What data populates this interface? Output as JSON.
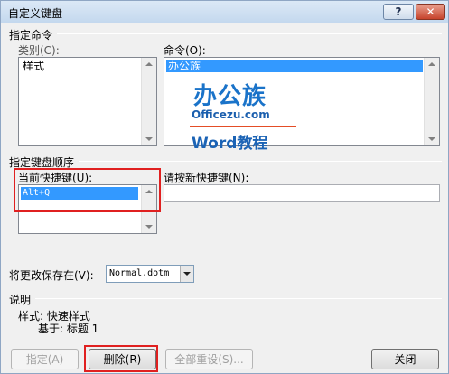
{
  "window": {
    "title": "自定义键盘",
    "help_label": "?",
    "close_label": "✕"
  },
  "commands": {
    "section_label": "指定命令",
    "categories_label": "类别(C):",
    "categories": [
      "样式"
    ],
    "commands_label": "命令(O):",
    "commands": [
      "办公族"
    ],
    "logo": {
      "main": "办公族",
      "url": "Officezu.com",
      "word": "Word教程"
    }
  },
  "keys": {
    "section_label": "指定键盘顺序",
    "current_label": "当前快捷键(U):",
    "current_keys": [
      "Alt+Q"
    ],
    "new_label": "请按新快捷键(N):",
    "new_value": ""
  },
  "save": {
    "label": "将更改保存在(V):",
    "value": "Normal.dotm"
  },
  "description": {
    "section_label": "说明",
    "line1": "样式: 快速样式",
    "line2": "基于: 标题 1"
  },
  "buttons": {
    "assign": "指定(A)",
    "delete": "删除(R)",
    "reset_all": "全部重设(S)...",
    "close": "关闭"
  },
  "colors": {
    "selection": "#3399ff",
    "highlight": "#e02020"
  }
}
